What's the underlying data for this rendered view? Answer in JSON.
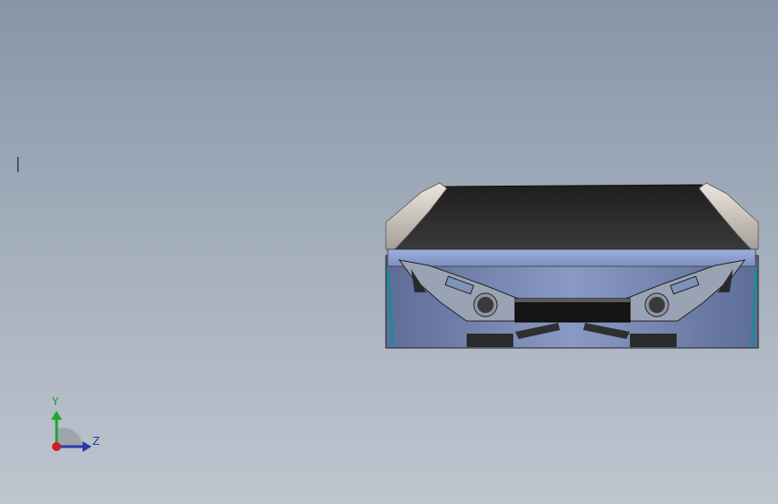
{
  "viewport": {
    "background_top": "#8795a8",
    "background_bottom": "#bfc5cf"
  },
  "model": {
    "subject": "car front view",
    "colors": {
      "body": "#6c7ea8",
      "hood": "#262626",
      "lamp_housing": "#9aa3b4",
      "fender": "#c9c3bd",
      "trim": "#1c8a96"
    }
  },
  "triad": {
    "y_label": "Y",
    "z_label": "Z",
    "y_color": "#22a330",
    "z_color": "#2b3aa8",
    "origin_color": "#cc1f1f"
  }
}
